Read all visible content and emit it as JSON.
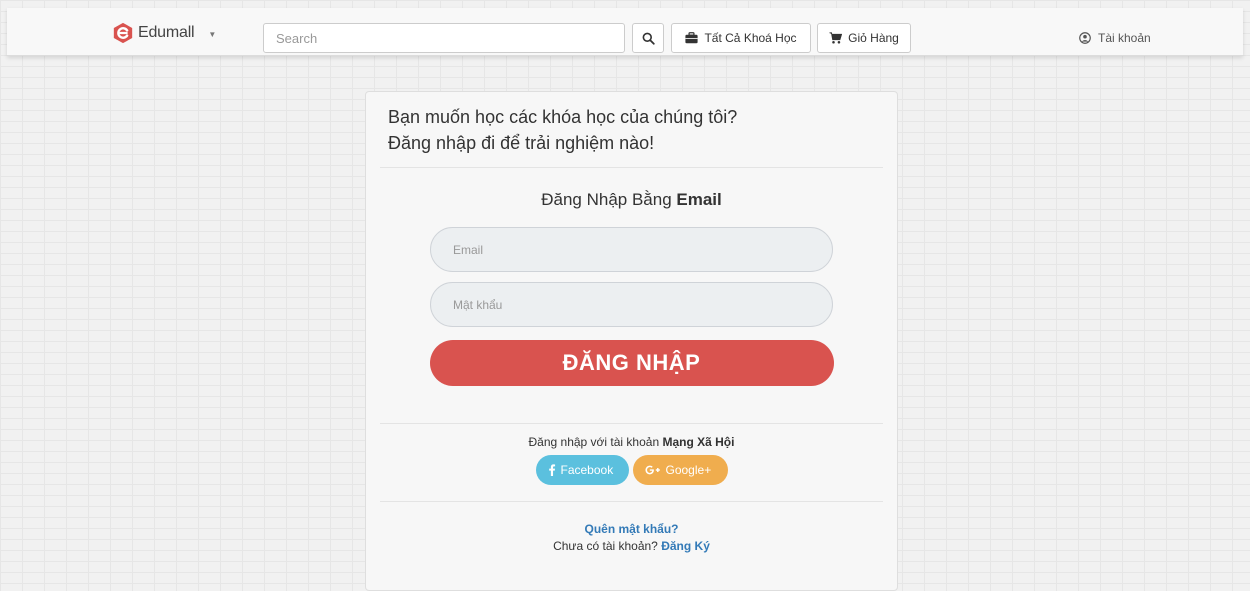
{
  "header": {
    "brand_name": "Edumall",
    "brand_color": "#d9534f",
    "search_placeholder": "Search",
    "all_courses_label": "Tất Cả Khoá Học",
    "cart_label": "Giỏ Hàng",
    "account_label": "Tài khoản"
  },
  "login": {
    "heading_line1": "Bạn muốn học các khóa học của chúng tôi?",
    "heading_line2": "Đăng nhập đi để trải nghiệm nào!",
    "title_prefix": "Đăng Nhập Bằng ",
    "title_bold": "Email",
    "email_placeholder": "Email",
    "password_placeholder": "Mật khẩu",
    "submit_label": "ĐĂNG NHẬP",
    "submit_color": "#d9534f"
  },
  "social": {
    "text_prefix": "Đăng nhập với tài khoản ",
    "text_bold": "Mạng Xã Hội",
    "facebook_label": "Facebook",
    "facebook_color": "#5bc0de",
    "google_label": "Google+",
    "google_color": "#f0ad4e"
  },
  "footer": {
    "forgot_label": "Quên mật khẩu?",
    "no_account_text": "Chưa có tài khoản? ",
    "signup_label": "Đăng Ký",
    "link_color": "#337ab7"
  },
  "icons": {
    "logo": "edumall-logo-icon",
    "caret": "caret-down-icon",
    "search": "search-icon",
    "courses": "briefcase-icon",
    "cart": "cart-icon",
    "account": "user-circle-icon",
    "facebook": "facebook-icon",
    "google": "google-plus-icon"
  }
}
